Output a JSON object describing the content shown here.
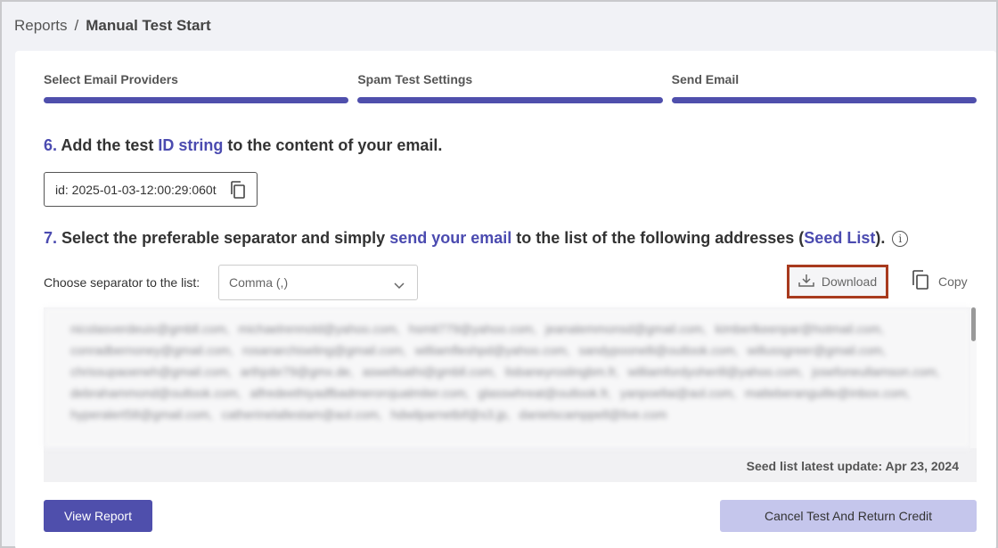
{
  "breadcrumb": {
    "parent": "Reports",
    "separator": "/",
    "current": "Manual Test Start"
  },
  "steps": [
    {
      "label": "Select Email Providers"
    },
    {
      "label": "Spam Test Settings"
    },
    {
      "label": "Send Email"
    }
  ],
  "step6": {
    "number": "6.",
    "text_a": "Add the test ",
    "highlight": "ID string",
    "text_b": " to the content of your email."
  },
  "id_box": {
    "value": "id: 2025-01-03-12:00:29:060t",
    "icon": "copy-icon"
  },
  "step7": {
    "number": "7.",
    "text_a": "Select the preferable separator and simply ",
    "highlight_a": "send your email",
    "text_b": " to the list of the following addresses (",
    "highlight_b": "Seed List",
    "text_c": ").",
    "info_icon": "info-icon"
  },
  "separator": {
    "label": "Choose separator to the list:",
    "selected": "Comma (,)"
  },
  "actions": {
    "download_label": "Download",
    "copy_label": "Copy"
  },
  "seed_list": {
    "text": "nicolasverdeuix@gmbll.com, michaelrennold@yahoo.com, hsmit779@yahoo.com, jeanalemmonsd@gmail.com, kimberlkeenpar@hotmail.com, conradbernoney@gmail.com, rosanarchiseling@gmail.com, williamfleshpd@yahoo.com, sandypoonelli@outlook.com, willussgreer@gmail.com, chrissupaoeneh@gmail.com, arthjobr79@gmx.de, aswellsathi@gmbll.com, lisbaneyroslingbm.fr, williamfordyoherill@yahoo.com, josefoneullamson.com, debrahammond@outlook.com, alfredeethiyadfbadmerorojualmiter.com, glasswhreat@outlook.fr, yanpoellai@aol.com, matteberanguille@inbox.com, hyperalert58@gmail.com, catherinelallestam@aol.com, hdwilparnetbif@s3.jp, danielscamppell@live.com",
    "update": "Seed list latest update: Apr 23, 2024"
  },
  "buttons": {
    "view_report": "View Report",
    "cancel": "Cancel Test And Return Credit"
  },
  "colors": {
    "accent": "#4f4fac",
    "highlight_border": "#a83a1e",
    "secondary_button": "#c5c6ec"
  }
}
